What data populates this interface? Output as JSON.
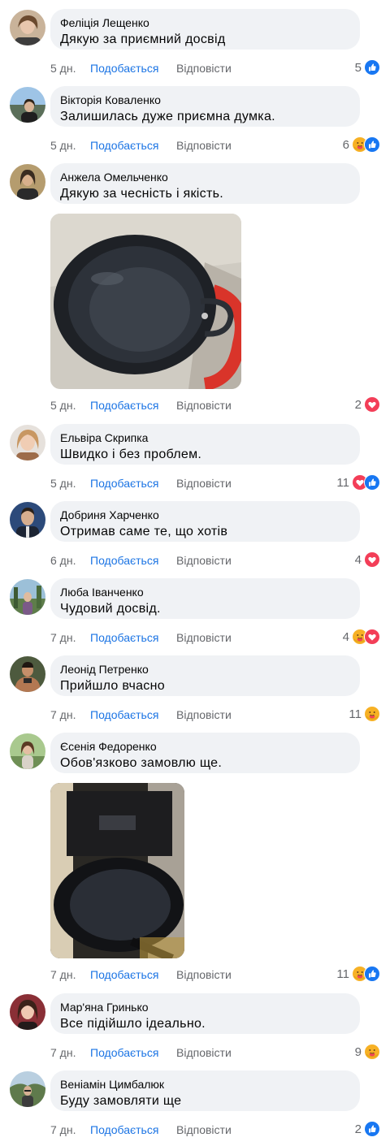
{
  "comments": [
    {
      "author": "Феліція Лещенко",
      "text": "Дякую за приємний досвід",
      "time": "5 дн.",
      "like": "Подобається",
      "reply": "Відповісти",
      "count": "5",
      "reactions": [
        "like"
      ]
    },
    {
      "author": "Вікторія Коваленко",
      "text": "Залишилась дуже приємна думка.",
      "time": "5 дн.",
      "like": "Подобається",
      "reply": "Відповісти",
      "count": "6",
      "reactions": [
        "care",
        "like"
      ]
    },
    {
      "author": "Анжела Омельченко",
      "text": "Дякую за чесність і якість.",
      "time": "5 дн.",
      "like": "Подобається",
      "reply": "Відповісти",
      "count": "2",
      "reactions": [
        "love"
      ]
    },
    {
      "author": "Ельвіра Скрипка",
      "text": "Швидко і без проблем.",
      "time": "5 дн.",
      "like": "Подобається",
      "reply": "Відповісти",
      "count": "11",
      "reactions": [
        "love",
        "like"
      ]
    },
    {
      "author": "Добриня Харченко",
      "text": "Отримав саме те, що хотів",
      "time": "6 дн.",
      "like": "Подобається",
      "reply": "Відповісти",
      "count": "4",
      "reactions": [
        "love"
      ]
    },
    {
      "author": "Люба Іванченко",
      "text": "Чудовий досвід.",
      "time": "7 дн.",
      "like": "Подобається",
      "reply": "Відповісти",
      "count": "4",
      "reactions": [
        "care",
        "love"
      ]
    },
    {
      "author": "Леонід Петренко",
      "text": "Прийшло вчасно",
      "time": "7 дн.",
      "like": "Подобається",
      "reply": "Відповісти",
      "count": "11",
      "reactions": [
        "care"
      ]
    },
    {
      "author": "Єсенія Федоренко",
      "text": "Обов'язково замовлю ще.",
      "time": "7 дн.",
      "like": "Подобається",
      "reply": "Відповісти",
      "count": "11",
      "reactions": [
        "care",
        "like"
      ]
    },
    {
      "author": "Мар'яна Гринько",
      "text": "Все підійшло ідеально.",
      "time": "7 дн.",
      "like": "Подобається",
      "reply": "Відповісти",
      "count": "9",
      "reactions": [
        "care"
      ]
    },
    {
      "author": "Веніамін Цимбалюк",
      "text": "Буду замовляти ще",
      "time": "7 дн.",
      "like": "Подобається",
      "reply": "Відповісти",
      "count": "2",
      "reactions": [
        "like"
      ]
    }
  ],
  "colors": {
    "like": "#1877f2",
    "love": "#f33e58",
    "care": "#f7b125",
    "link": "#1b74e4",
    "meta": "#65676b",
    "bubble": "#f0f2f5"
  }
}
